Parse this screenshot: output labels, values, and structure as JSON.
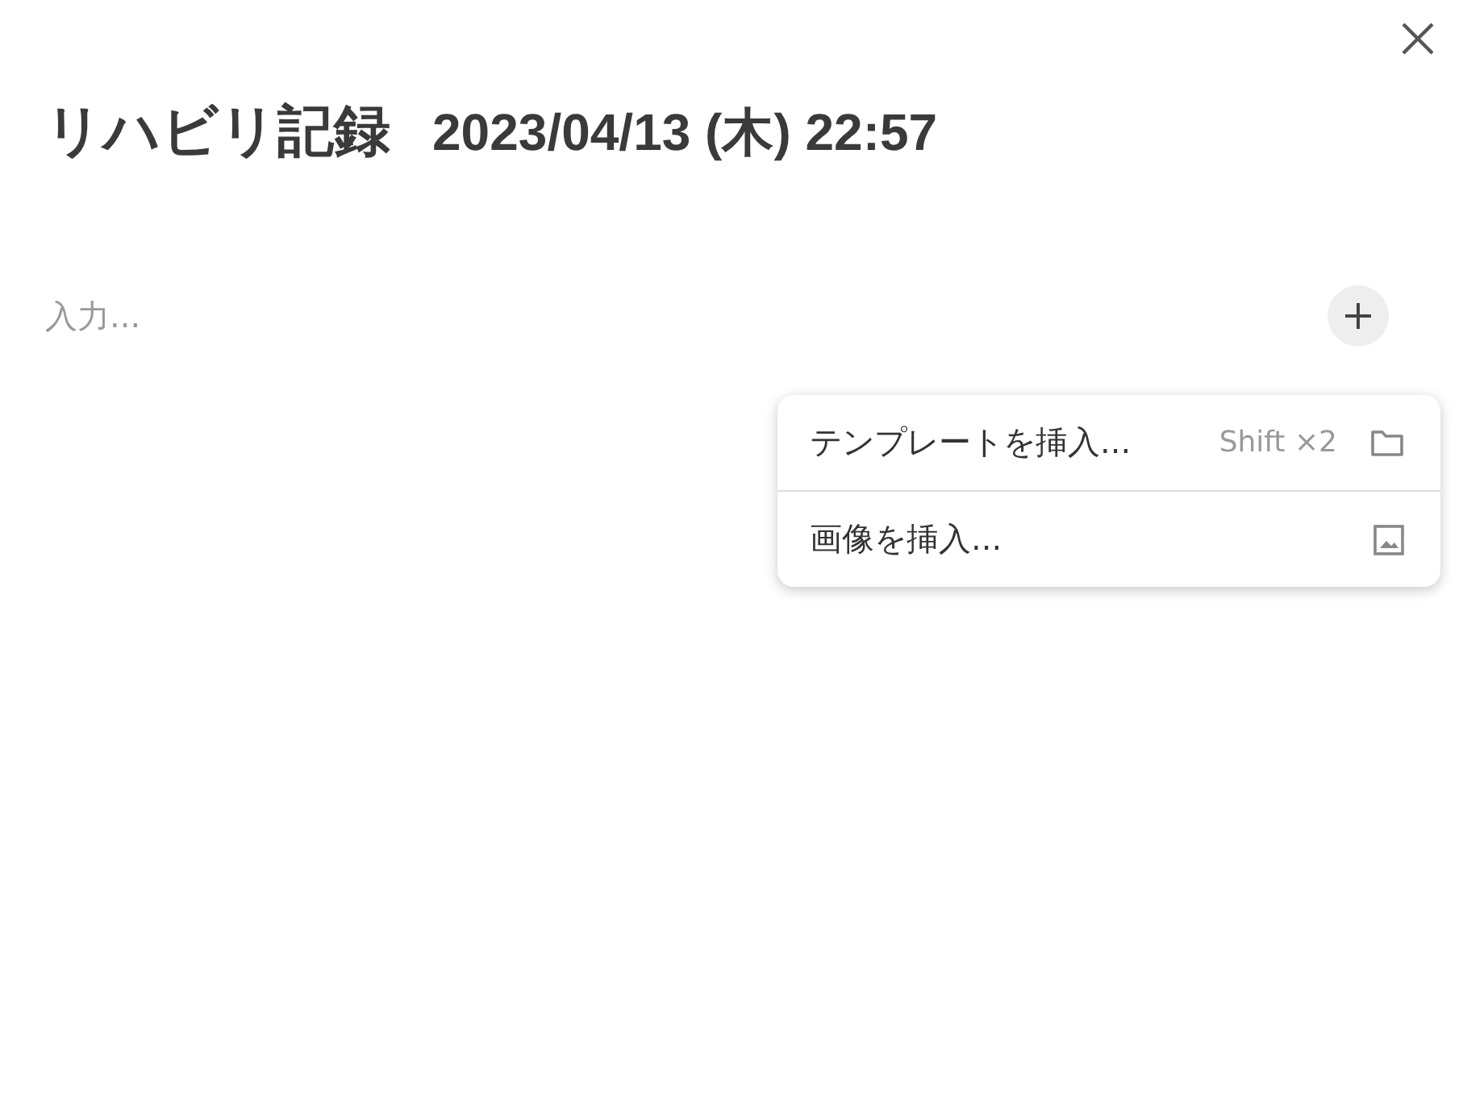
{
  "title": "リハビリ記録",
  "datetime": "2023/04/13 (木) 22:57",
  "editor": {
    "placeholder": "入力..."
  },
  "menu": [
    {
      "label": "テンプレートを挿入...",
      "shortcut": "Shift ×2",
      "kind": "folder"
    },
    {
      "label": "画像を挿入...",
      "kind": "image"
    }
  ]
}
